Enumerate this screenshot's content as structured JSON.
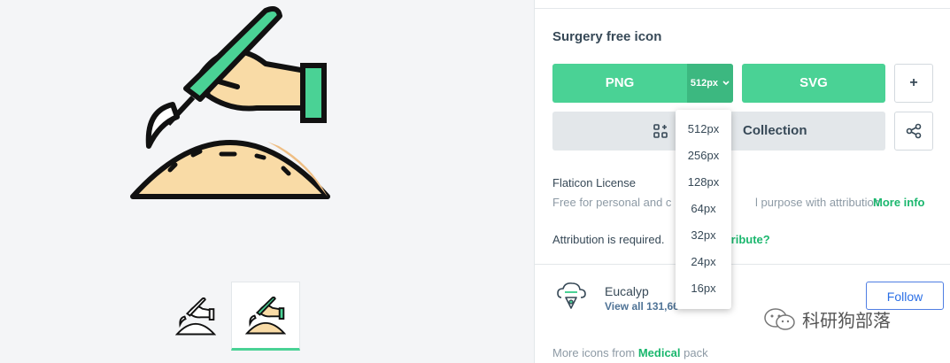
{
  "icon": {
    "title": "Surgery free icon",
    "colors": {
      "accent": "#4ad295",
      "skin": "#f9dba6",
      "outline": "#111111",
      "link": "#1bb76e"
    }
  },
  "download": {
    "png_label": "PNG",
    "size_selected": "512px",
    "svg_label": "SVG",
    "plus_label": "+",
    "collection_label": "Collection",
    "size_options": [
      "512px",
      "256px",
      "128px",
      "64px",
      "32px",
      "24px",
      "16px"
    ]
  },
  "license": {
    "title": "Flaticon License",
    "desc_part1": "Free for personal and c",
    "desc_part2": "l purpose with attribution.",
    "more_info": "More info",
    "attribution_text": "Attribution is required.",
    "attribution_link": "ttribute?"
  },
  "author": {
    "name": "Eucalyp",
    "view_all": "View all 131,66",
    "follow_label": "Follow"
  },
  "watermark": {
    "text": "科研狗部落"
  },
  "more_icons": {
    "prefix": "More icons from",
    "pack_name": "Medical",
    "suffix": "pack"
  },
  "icons": {
    "thumb1": "surgery-outline-icon",
    "thumb2": "surgery-filled-icon",
    "chevron": "chevron-down-icon",
    "collection": "add-grid-icon",
    "share": "share-icon",
    "author_logo": "eucalyp-logo-icon",
    "wechat": "wechat-logo-icon"
  }
}
